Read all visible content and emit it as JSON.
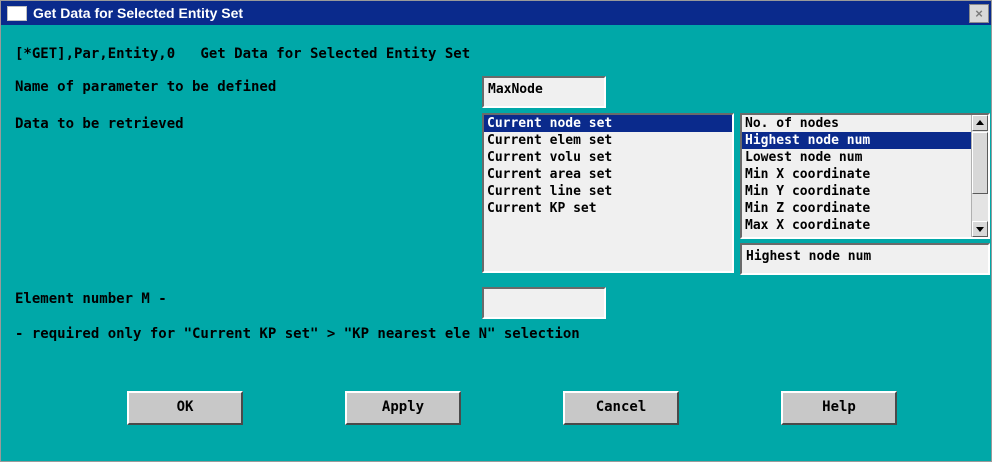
{
  "window": {
    "title": "Get Data for Selected Entity Set",
    "close_label": "×"
  },
  "header_line": "[*GET],Par,Entity,0   Get Data for Selected Entity Set",
  "param": {
    "label": "Name of parameter to be defined",
    "value": "MaxNode"
  },
  "data_retrieved": {
    "label": "Data to be retrieved",
    "entity_sets": [
      "Current node set",
      "Current elem set",
      "Current volu set",
      "Current area set",
      "Current line set",
      "Current KP set"
    ],
    "entity_selected": 0,
    "items": [
      "No. of nodes",
      "Highest node num",
      "Lowest node num",
      "Min X coordinate",
      "Min Y coordinate",
      "Min Z coordinate",
      "Max X coordinate"
    ],
    "item_selected": 1,
    "selection_display": "Highest node num"
  },
  "element": {
    "label": "Element number M -",
    "value": "",
    "note": "- required only for \"Current KP set\" > \"KP nearest ele N\" selection"
  },
  "buttons": {
    "ok": "OK",
    "apply": "Apply",
    "cancel": "Cancel",
    "help": "Help"
  },
  "colors": {
    "background": "#00a8a8",
    "titlebar": "#0a2a8c",
    "selection": "#0a2a8c",
    "field": "#f0f0f0"
  }
}
